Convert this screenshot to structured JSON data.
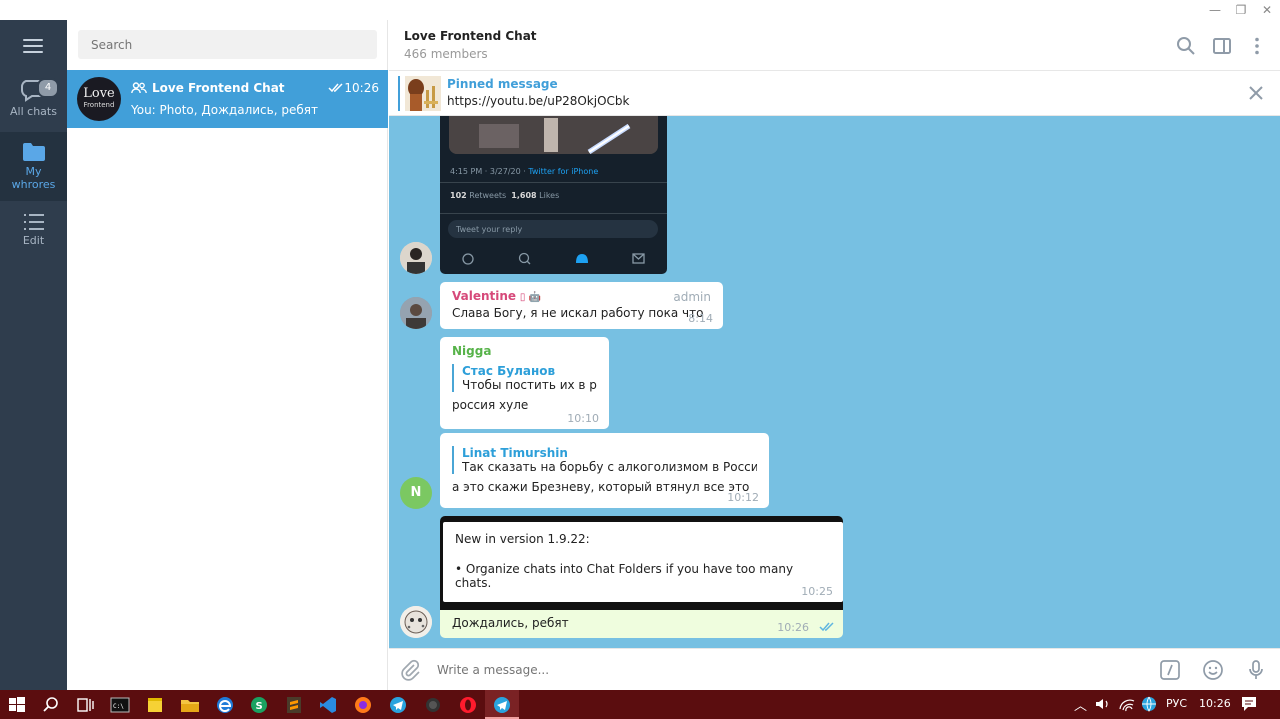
{
  "window": {
    "minimize_glyph": "—",
    "restore_glyph": "❐",
    "close_glyph": "✕"
  },
  "folders": {
    "items": [
      {
        "label": "All chats",
        "badge": "4",
        "icon": "chat-bubble-icon"
      },
      {
        "label": "My\nwhrores",
        "icon": "folder-icon",
        "active": true
      },
      {
        "label": "Edit",
        "icon": "list-edit-icon"
      }
    ]
  },
  "chatlist": {
    "search_placeholder": "Search",
    "chats": [
      {
        "avatar_line1": "Love",
        "avatar_line2": "Frontend",
        "name": "Love Frontend Chat",
        "time": "10:26",
        "preview": "You: Photo, Дождались, ребят"
      }
    ]
  },
  "header": {
    "title": "Love Frontend Chat",
    "subtitle": "466 members"
  },
  "pinned": {
    "title": "Pinned message",
    "text": "https://youtu.be/uP28OkjOCbk"
  },
  "tweet": {
    "meta_time": "4:15 PM · 3/27/20 ·",
    "meta_source": "Twitter for iPhone",
    "retweets_num": "102",
    "retweets_label": "Retweets",
    "likes_num": "1,608",
    "likes_label": "Likes",
    "reply_placeholder": "Tweet your reply"
  },
  "messages": [
    {
      "sender": "Valentine",
      "sender_color": "#d6497a",
      "role": "admin",
      "text": "Слава Богу, я не искал работу пока что",
      "time": "8:14"
    },
    {
      "sender": "Nigga",
      "sender_color": "#57b34a",
      "reply_name": "Стас Буланов",
      "reply_text": "Чтобы постить их в р...",
      "text": "россия хуле",
      "time": "10:10"
    },
    {
      "reply_name": "Linat Timurshin",
      "reply_text": "Так сказать на борьбу с алкоголизмом в России...",
      "text": "а это скажи Брезневу, который втянул все это",
      "time": "10:12",
      "avatar_letter": "N"
    },
    {
      "line1": "New in version 1.9.22:",
      "line2": "• Organize chats into Chat Folders if you have too many chats.",
      "time": "10:25"
    },
    {
      "text": "Дождались, ребят",
      "time": "10:26"
    }
  ],
  "composer": {
    "placeholder": "Write a message..."
  },
  "taskbar": {
    "lang": "РУС",
    "clock": "10:26",
    "tray_up": "^"
  },
  "colors": {
    "accent": "#419fd9",
    "chat_bg": "#77c0e2",
    "sidebar": "#2f3d4d",
    "taskbar": "#5b0d0f"
  }
}
